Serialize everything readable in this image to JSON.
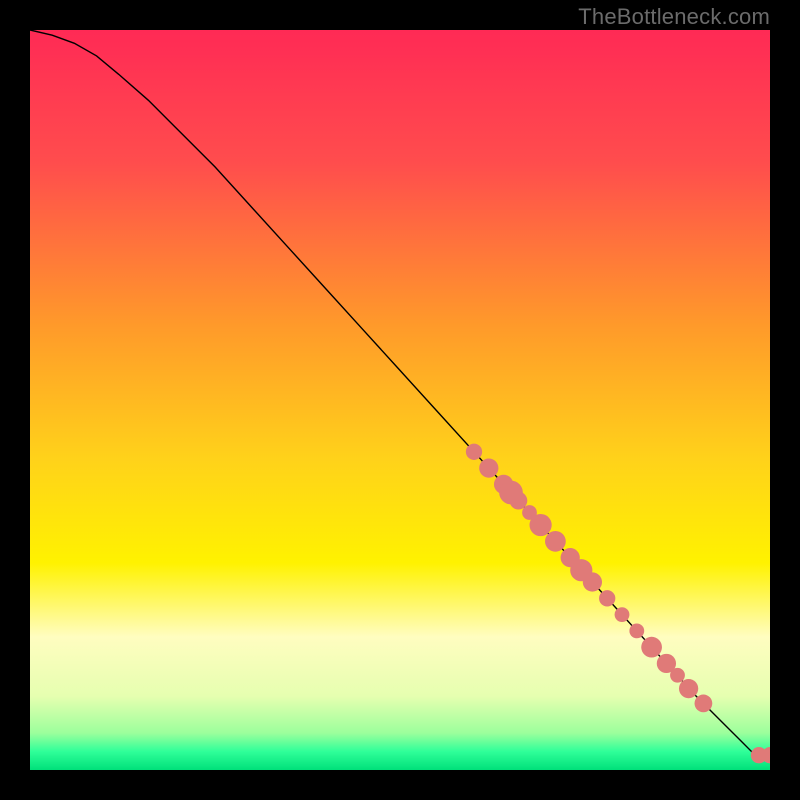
{
  "attribution": "TheBottleneck.com",
  "chart_data": {
    "type": "line",
    "title": "",
    "xlabel": "",
    "ylabel": "",
    "xlim": [
      0,
      100
    ],
    "ylim": [
      0,
      100
    ],
    "grid": false,
    "legend": false,
    "background_gradient_stops": [
      {
        "offset": 0.0,
        "color": "#ff2a55"
      },
      {
        "offset": 0.18,
        "color": "#ff4d4d"
      },
      {
        "offset": 0.4,
        "color": "#ff9a2a"
      },
      {
        "offset": 0.58,
        "color": "#ffd21a"
      },
      {
        "offset": 0.72,
        "color": "#fff200"
      },
      {
        "offset": 0.82,
        "color": "#fffdc0"
      },
      {
        "offset": 0.9,
        "color": "#e6ffb0"
      },
      {
        "offset": 0.95,
        "color": "#9cff9c"
      },
      {
        "offset": 0.975,
        "color": "#2fff99"
      },
      {
        "offset": 1.0,
        "color": "#00e07a"
      }
    ],
    "series": [
      {
        "name": "curve",
        "color": "#000000",
        "stroke_width": 1.4,
        "x": [
          0,
          3,
          6,
          9,
          12,
          16,
          20,
          25,
          30,
          35,
          40,
          45,
          50,
          55,
          60,
          65,
          70,
          75,
          80,
          85,
          90,
          93,
          96,
          98,
          100
        ],
        "y": [
          100,
          99.3,
          98.2,
          96.5,
          94.0,
          90.5,
          86.5,
          81.5,
          76.0,
          70.5,
          65.0,
          59.5,
          54.0,
          48.5,
          43.0,
          37.5,
          32.0,
          26.5,
          21.0,
          15.5,
          10.0,
          7.0,
          4.0,
          2.0,
          2.0
        ]
      }
    ],
    "scatter_points": {
      "name": "markers",
      "color": "#e07a78",
      "radius_base": 1.0,
      "points": [
        {
          "x": 60.0,
          "y": 43.0,
          "r": 1.1
        },
        {
          "x": 62.0,
          "y": 40.8,
          "r": 1.3
        },
        {
          "x": 64.0,
          "y": 38.6,
          "r": 1.3
        },
        {
          "x": 65.0,
          "y": 37.5,
          "r": 1.6
        },
        {
          "x": 66.0,
          "y": 36.4,
          "r": 1.2
        },
        {
          "x": 67.5,
          "y": 34.8,
          "r": 1.0
        },
        {
          "x": 69.0,
          "y": 33.1,
          "r": 1.5
        },
        {
          "x": 71.0,
          "y": 30.9,
          "r": 1.4
        },
        {
          "x": 73.0,
          "y": 28.7,
          "r": 1.3
        },
        {
          "x": 74.5,
          "y": 27.0,
          "r": 1.5
        },
        {
          "x": 76.0,
          "y": 25.4,
          "r": 1.3
        },
        {
          "x": 78.0,
          "y": 23.2,
          "r": 1.1
        },
        {
          "x": 80.0,
          "y": 21.0,
          "r": 1.0
        },
        {
          "x": 82.0,
          "y": 18.8,
          "r": 1.0
        },
        {
          "x": 84.0,
          "y": 16.6,
          "r": 1.4
        },
        {
          "x": 86.0,
          "y": 14.4,
          "r": 1.3
        },
        {
          "x": 87.5,
          "y": 12.8,
          "r": 1.0
        },
        {
          "x": 89.0,
          "y": 11.0,
          "r": 1.3
        },
        {
          "x": 91.0,
          "y": 9.0,
          "r": 1.2
        },
        {
          "x": 98.5,
          "y": 2.0,
          "r": 1.1
        },
        {
          "x": 100.0,
          "y": 2.0,
          "r": 1.1
        }
      ]
    }
  }
}
